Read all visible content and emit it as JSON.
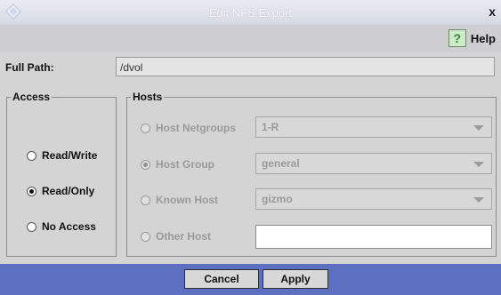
{
  "window": {
    "title": "Edit NFS Export",
    "close_glyph": "x",
    "help_label": "Help",
    "help_icon_glyph": "?"
  },
  "full_path": {
    "label": "Full Path:",
    "value": "/dvol"
  },
  "access": {
    "legend": "Access",
    "options": [
      {
        "label": "Read/Write",
        "selected": false
      },
      {
        "label": "Read/Only",
        "selected": true
      },
      {
        "label": "No Access",
        "selected": false
      }
    ]
  },
  "hosts": {
    "legend": "Hosts",
    "host_netgroups": {
      "label": "Host Netgroups",
      "value": "1-R",
      "selected": false
    },
    "host_group": {
      "label": "Host Group",
      "value": "general",
      "selected": true
    },
    "known_host": {
      "label": "Known Host",
      "value": "gizmo",
      "selected": false
    },
    "other_host": {
      "label": "Other Host",
      "value": "",
      "selected": false
    }
  },
  "buttons": {
    "cancel": "Cancel",
    "apply": "Apply"
  },
  "colors": {
    "footer": "#5d6fc1",
    "background": "#d4d4d4"
  },
  "icons": {
    "app": "diamond-icon",
    "help": "help-icon",
    "close": "close-icon"
  }
}
